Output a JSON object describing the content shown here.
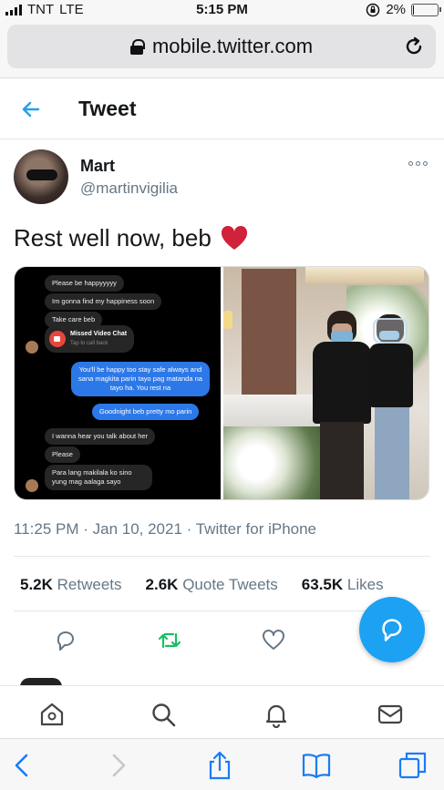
{
  "status_bar": {
    "carrier": "TNT",
    "network": "LTE",
    "time": "5:15 PM",
    "battery_percent": "2%",
    "battery_level": 0.02
  },
  "browser": {
    "url": "mobile.twitter.com"
  },
  "header": {
    "title": "Tweet"
  },
  "tweet": {
    "author_name": "Mart",
    "author_handle": "@martinvigilia",
    "text": "Rest well now, beb",
    "emoji": "heart",
    "timestamp": "11:25 PM · Jan 10, 2021",
    "source": "Twitter for iPhone",
    "retweets_count": "5.2K",
    "retweets_label": "Retweets",
    "quote_count": "2.6K",
    "quote_label": "Quote Tweets",
    "likes_count": "63.5K",
    "likes_label": "Likes"
  },
  "chat_screenshot": {
    "messages": [
      "Please be happyyyyy",
      "Im gonna find my happiness soon",
      "Take care beb"
    ],
    "missed_call_title": "Missed Video Chat",
    "missed_call_sub": "Tap to call back",
    "my_messages": [
      "You'll be happy too stay safe always and sana magkita parin tayo pag matanda na tayo ha. You rest na",
      "Goodnight beb pretty mo parin"
    ],
    "later_messages": [
      "I wanna hear you talk about her",
      "Please",
      "Para lang makilala ko sino yung mag aalaga sayo"
    ]
  },
  "colors": {
    "accent": "#1da1f2",
    "heart": "#e0245e",
    "retweet": "#17bf63",
    "muted": "#657786"
  },
  "icons": {
    "header_back": "back-arrow-icon",
    "actions": [
      "reply-icon",
      "retweet-icon",
      "like-icon"
    ],
    "fab": "compose-icon",
    "tw_nav": [
      "home-icon",
      "search-icon",
      "notifications-icon",
      "messages-icon"
    ],
    "safari": [
      "back-icon",
      "forward-icon",
      "share-icon",
      "bookmarks-icon",
      "tabs-icon"
    ]
  }
}
